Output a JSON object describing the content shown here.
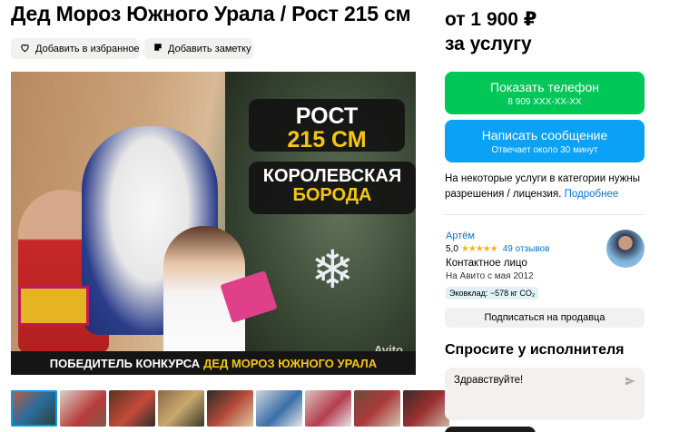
{
  "listing": {
    "title": "Дед Мороз Южного Урала / Рост 215 см",
    "favorite_label": "Добавить в избранное",
    "note_label": "Добавить заметку"
  },
  "photo": {
    "overlay_height_line1": "РОСТ",
    "overlay_height_line2": "215 СМ",
    "overlay_beard_line1": "КОРОЛЕВСКАЯ",
    "overlay_beard_line2": "БОРОДА",
    "bottom_banner_white": "ПОБЕДИТЕЛЬ КОНКУРСА",
    "bottom_banner_yellow": "ДЕД МОРОЗ ЮЖНОГО УРАЛА",
    "watermark": "Avito"
  },
  "thumbnails": {
    "count": 9,
    "selected_index": 0
  },
  "price": {
    "amount": "от 1 900 ₽",
    "unit": "за услугу"
  },
  "actions": {
    "phone_label": "Показать телефон",
    "phone_number": "8 909 XXX-XX-XX",
    "message_label": "Написать сообщение",
    "message_sub": "Отвечает около 30 минут"
  },
  "license": {
    "text": "На некоторые услуги в категории нужны разрешения / лицензия.",
    "link": "Подробнее"
  },
  "seller": {
    "name": "Артём",
    "rating": "5,0",
    "stars": 5,
    "reviews": "49 отзывов",
    "role": "Контактное лицо",
    "since": "На Авито с мая 2012",
    "eco": "Эковклад: −578 кг CO₂",
    "subscribe_label": "Подписаться на продавца"
  },
  "ask": {
    "title": "Спросите у исполнителя",
    "input_value": "Здравствуйте!"
  },
  "colors": {
    "phone_button": "#00c758",
    "message_button": "#0ba1f7",
    "link": "#0a73d6",
    "star": "#ffb021",
    "banner_yellow": "#f6c614"
  },
  "icons": {
    "favorite": "heart-icon",
    "note": "note-icon",
    "send": "send-icon",
    "star": "star-icon"
  }
}
